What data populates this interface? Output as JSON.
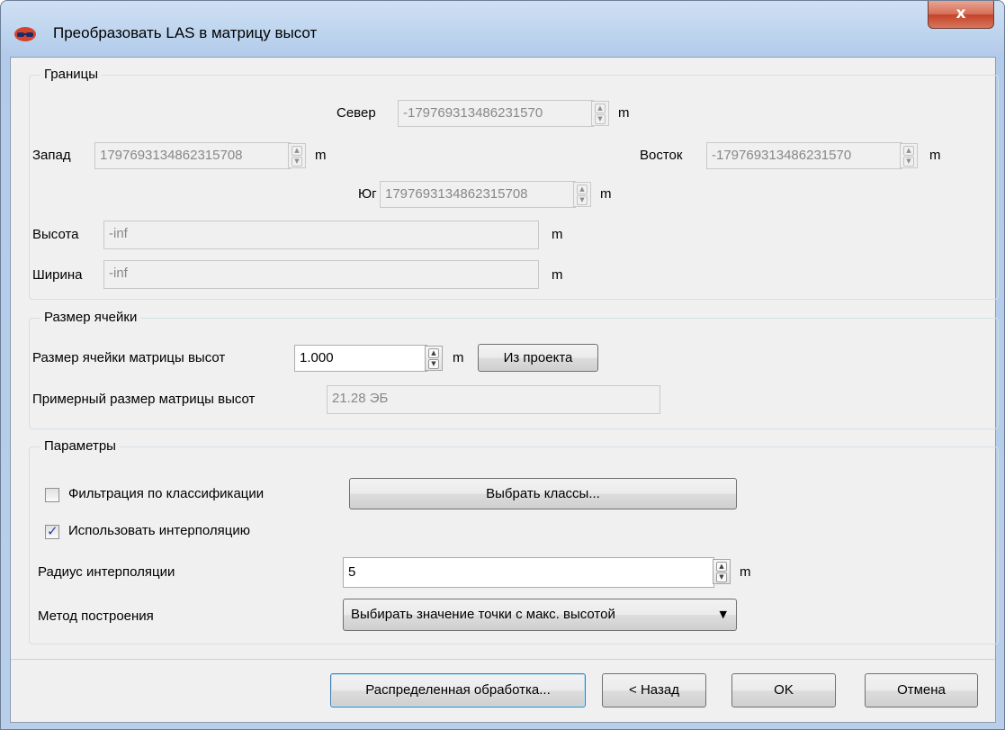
{
  "window": {
    "title": "Преобразовать LAS в матрицу высот",
    "close_label": "x"
  },
  "bounds": {
    "title": "Границы",
    "north": {
      "label": "Север",
      "value": "-179769313486231570",
      "unit": "m"
    },
    "west": {
      "label": "Запад",
      "value": "1797693134862315708",
      "unit": "m"
    },
    "east": {
      "label": "Восток",
      "value": "-179769313486231570",
      "unit": "m"
    },
    "south": {
      "label": "Юг",
      "value": "1797693134862315708",
      "unit": "m"
    },
    "height": {
      "label": "Высота",
      "value": "-inf",
      "unit": "m"
    },
    "width": {
      "label": "Ширина",
      "value": "-inf",
      "unit": "m"
    }
  },
  "cell": {
    "title": "Размер ячейки",
    "size_label": "Размер ячейки матрицы высот",
    "size_value": "1.000",
    "size_unit": "m",
    "from_project": "Из проекта",
    "approx_label": "Примерный размер матрицы высот",
    "approx_value": "21.28 ЭБ"
  },
  "params": {
    "title": "Параметры",
    "filter_label": "Фильтрация по классификации",
    "filter_checked": false,
    "select_classes": "Выбрать классы...",
    "interp_label": "Использовать интерполяцию",
    "interp_checked": true,
    "radius_label": "Радиус интерполяции",
    "radius_value": "5",
    "radius_unit": "m",
    "method_label": "Метод построения",
    "method_value": "Выбирать значение точки с макс. высотой"
  },
  "buttons": {
    "distributed": "Распределенная обработка...",
    "back": "< Назад",
    "ok": "OK",
    "cancel": "Отмена"
  },
  "icons": {
    "spin_up": "▲",
    "spin_down": "▼",
    "check": "✓",
    "dropdown": "▼"
  }
}
